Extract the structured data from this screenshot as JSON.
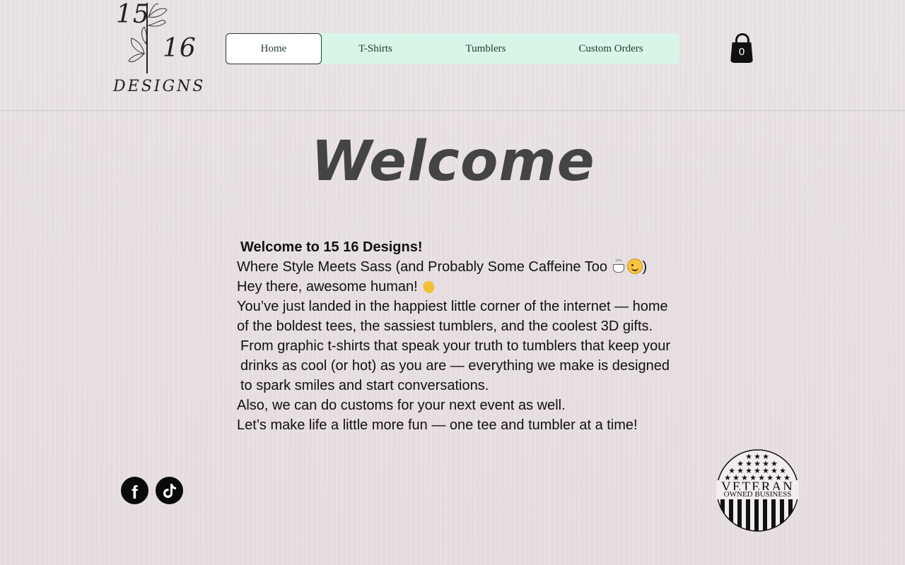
{
  "brand": {
    "logo_num1": "15",
    "logo_num2": "16",
    "logo_word": "DESIGNS"
  },
  "nav": {
    "items": [
      {
        "label": "Home",
        "active": true
      },
      {
        "label": "T-Shirts",
        "active": false
      },
      {
        "label": "Tumblers",
        "active": false
      },
      {
        "label": "Custom Orders",
        "active": false
      }
    ],
    "active_bg": "#ffffff",
    "bar_bg": "#d8f6e8"
  },
  "cart": {
    "count": "0",
    "icon": "shopping-bag-icon"
  },
  "hero": {
    "title": "Welcome"
  },
  "intro": {
    "heading": "Welcome to 15 16 Designs!",
    "line1": "Where Style Meets Sass (and Probably Some Caffeine Too",
    "line1_close": ")",
    "line2": "Hey there, awesome human!",
    "para1": "You’ve just landed in the happiest little corner of the internet — home of the boldest tees, the sassiest tumblers, and the coolest 3D gifts.",
    "para2": "From graphic t-shirts that speak your truth to tumblers that keep your drinks as cool (or hot) as you are — everything we make is designed to spark smiles and start conversations.",
    "para3": "Also, we can do customs for your next event as well.",
    "para4": "Let’s make life a little more fun — one tee and tumbler at a time!"
  },
  "social": {
    "facebook_icon": "facebook-icon",
    "tiktok_icon": "tiktok-icon"
  },
  "badge": {
    "line1": "VETERAN",
    "line2": "OWNED BUSINESS"
  },
  "colors": {
    "title": "#444444",
    "nav_text": "#1f3a33",
    "text": "#111111"
  }
}
